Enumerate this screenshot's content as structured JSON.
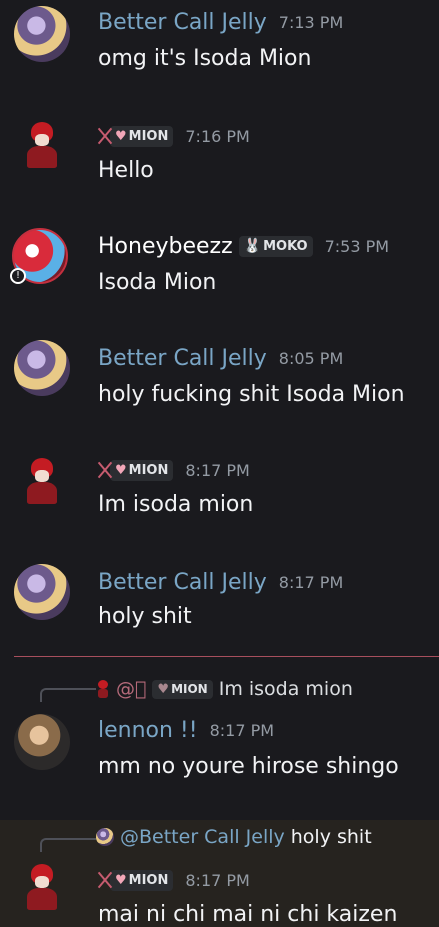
{
  "messages": [
    {
      "username": "Better Call Jelly",
      "time": "7:13 PM",
      "text": "omg it's Isoda Mion"
    },
    {
      "tag": "MION",
      "time": "7:16 PM",
      "text": "Hello"
    },
    {
      "username": "Honeybeezz",
      "tag": "MOKO",
      "time": "7:53 PM",
      "text": "Isoda Mion"
    },
    {
      "username": "Better Call Jelly",
      "time": "8:05 PM",
      "text": "holy fucking shit Isoda Mion"
    },
    {
      "tag": "MION",
      "time": "8:17 PM",
      "text": "Im isoda mion"
    },
    {
      "username": "Better Call Jelly",
      "time": "8:17 PM",
      "text": "holy shit"
    },
    {
      "reply": {
        "mention": "@\u0000",
        "tag": "MION",
        "text": "Im isoda mion"
      },
      "username": "lennon !!",
      "time": "8:17 PM",
      "text": "mm no youre hirose shingo"
    },
    {
      "reply": {
        "mention": "@Better Call Jelly",
        "text": "holy shit"
      },
      "tag": "MION",
      "time": "8:17 PM",
      "text": "mai ni chi mai ni chi kaizen"
    }
  ],
  "colors": {
    "background": "#1a1a1e",
    "username": "#7aa6c6",
    "timestamp": "#949ba4",
    "divider": "#a84f5d",
    "highlight": "#26231f"
  }
}
